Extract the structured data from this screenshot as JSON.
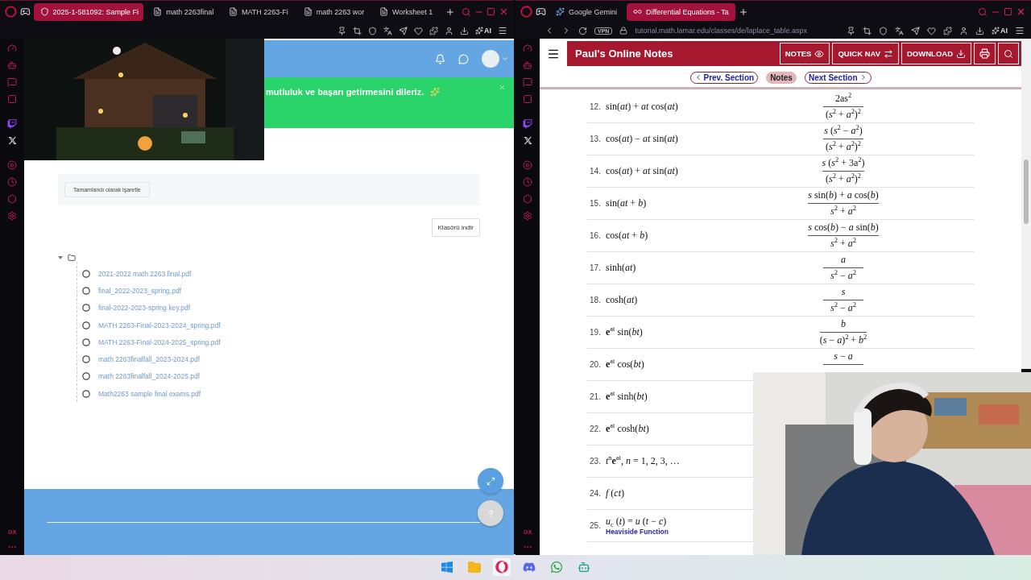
{
  "left_window": {
    "tabs": [
      {
        "label": "2025-1-581092: Sample Fi",
        "selected": true,
        "kind": "crest"
      },
      {
        "label": "math 2263final",
        "selected": false,
        "kind": "document"
      },
      {
        "label": "MATH 2263-Fi",
        "selected": false,
        "kind": "document"
      },
      {
        "label": "math 2263 wor",
        "selected": false,
        "kind": "document"
      },
      {
        "label": "Worksheet 1",
        "selected": false,
        "kind": "document"
      }
    ],
    "toolbar": {
      "ai_label": "AI"
    },
    "sidebar": {
      "footer_label": "GX"
    },
    "page": {
      "banner": {
        "text": "mutluluk ve başarı getirmesini dileriz."
      },
      "mark_complete_button": "Tamamlandı olarak işaretle",
      "download_folder_button": "Klasörü indir",
      "folder": {
        "expanded": true,
        "children": [
          {
            "name": "2021-2022 math 2263 final.pdf"
          },
          {
            "name": "final_2022-2023_spring.pdf"
          },
          {
            "name": "final-2022-2023-spring key.pdf"
          },
          {
            "name": "MATH 2263-Final-2023-2024_spring.pdf"
          },
          {
            "name": "MATH 2263-Final-2024-2025_spring.pdf"
          },
          {
            "name": "math 2263finalfall_2023-2024.pdf"
          },
          {
            "name": "math 2263finalfall_2024-2025.pdf"
          },
          {
            "name": "Math2263 sample final exams.pdf"
          }
        ]
      }
    }
  },
  "right_window": {
    "tabs": [
      {
        "label": "Google Gemini",
        "selected": false,
        "kind": "assistant"
      },
      {
        "label": "Differential Equations - Ta",
        "selected": true,
        "kind": "logo"
      }
    ],
    "address": "tutorial.math.lamar.edu/classes/de/laplace_table.aspx",
    "toolbar": {
      "vpn_label": "VPN",
      "ai_label": "AI"
    },
    "sidebar": {
      "footer_label": "GX"
    },
    "site": {
      "title": "Paul's Online Notes",
      "header_buttons": [
        {
          "label": "NOTES",
          "kind": "eye"
        },
        {
          "label": "QUICK NAV",
          "kind": "swap"
        },
        {
          "label": "DOWNLOAD",
          "kind": "download"
        }
      ],
      "nav": [
        {
          "label": "Prev. Section",
          "selected": false,
          "kind": "prev"
        },
        {
          "label": "Notes",
          "selected": true,
          "kind": "plain"
        },
        {
          "label": "Next Section",
          "selected": false,
          "kind": "next"
        }
      ],
      "table": {
        "rows": [
          {
            "number": "12.",
            "function": "sin(*at*) + *at* cos(*at*)",
            "transform": {
              "numerator": "2as$^{2}$",
              "denominator": "(*s*$^{2}$ + *a*$^{2}$)$^{2}$"
            }
          },
          {
            "number": "13.",
            "function": "cos(*at*) − *at* sin(*at*)",
            "transform": {
              "numerator": "*s* (*s*$^{2}$ − *a*$^{2}$)",
              "denominator": "(*s*$^{2}$ + *a*$^{2}$)$^{2}$"
            }
          },
          {
            "number": "14.",
            "function": "cos(*at*) + *at* sin(*at*)",
            "transform": {
              "numerator": "*s* (*s*$^{2}$ + 3a$^{2}$)",
              "denominator": "(*s*$^{2}$ + *a*$^{2}$)$^{2}$"
            }
          },
          {
            "number": "15.",
            "function": "sin(*at* + *b*)",
            "transform": {
              "numerator": "*s* sin(*b*) + *a* cos(*b*)",
              "denominator": "*s*$^{2}$ + *a*$^{2}$"
            }
          },
          {
            "number": "16.",
            "function": "cos(*at* + *b*)",
            "transform": {
              "numerator": "*s* cos(*b*) − *a* sin(*b*)",
              "denominator": "*s*$^{2}$ + *a*$^{2}$"
            }
          },
          {
            "number": "17.",
            "function": "sinh(*at*)",
            "transform": {
              "numerator": "*a*",
              "denominator": "*s*$^{2}$ − *a*$^{2}$"
            }
          },
          {
            "number": "18.",
            "function": "cosh(*at*)",
            "transform": {
              "numerator": "*s*",
              "denominator": "*s*$^{2}$ − *a*$^{2}$"
            }
          },
          {
            "number": "19.",
            "function": "**e**$^{at}$ sin(*bt*)",
            "transform": {
              "numerator": "*b*",
              "denominator": "(*s* − *a*)$^{2}$ + *b*$^{2}$"
            }
          },
          {
            "number": "20.",
            "function": "**e**$^{at}$ cos(*bt*)",
            "transform": {
              "numerator": "*s* − *a*"
            }
          },
          {
            "number": "21.",
            "function": "**e**$^{at}$ sinh(*bt*)"
          },
          {
            "number": "22.",
            "function": "**e**$^{at}$ cosh(*bt*)"
          },
          {
            "number": "23.",
            "function": "*t*$^{n}$**e**$^{at}$,   *n* = 1, 2, 3, …"
          },
          {
            "number": "24.",
            "function": "*f* (*ct*)"
          },
          {
            "number": "25.",
            "function": "*u*$_{c}$ (*t*) = *u* (*t* − *c*)",
            "link": "Heaviside Function"
          }
        ]
      }
    }
  }
}
